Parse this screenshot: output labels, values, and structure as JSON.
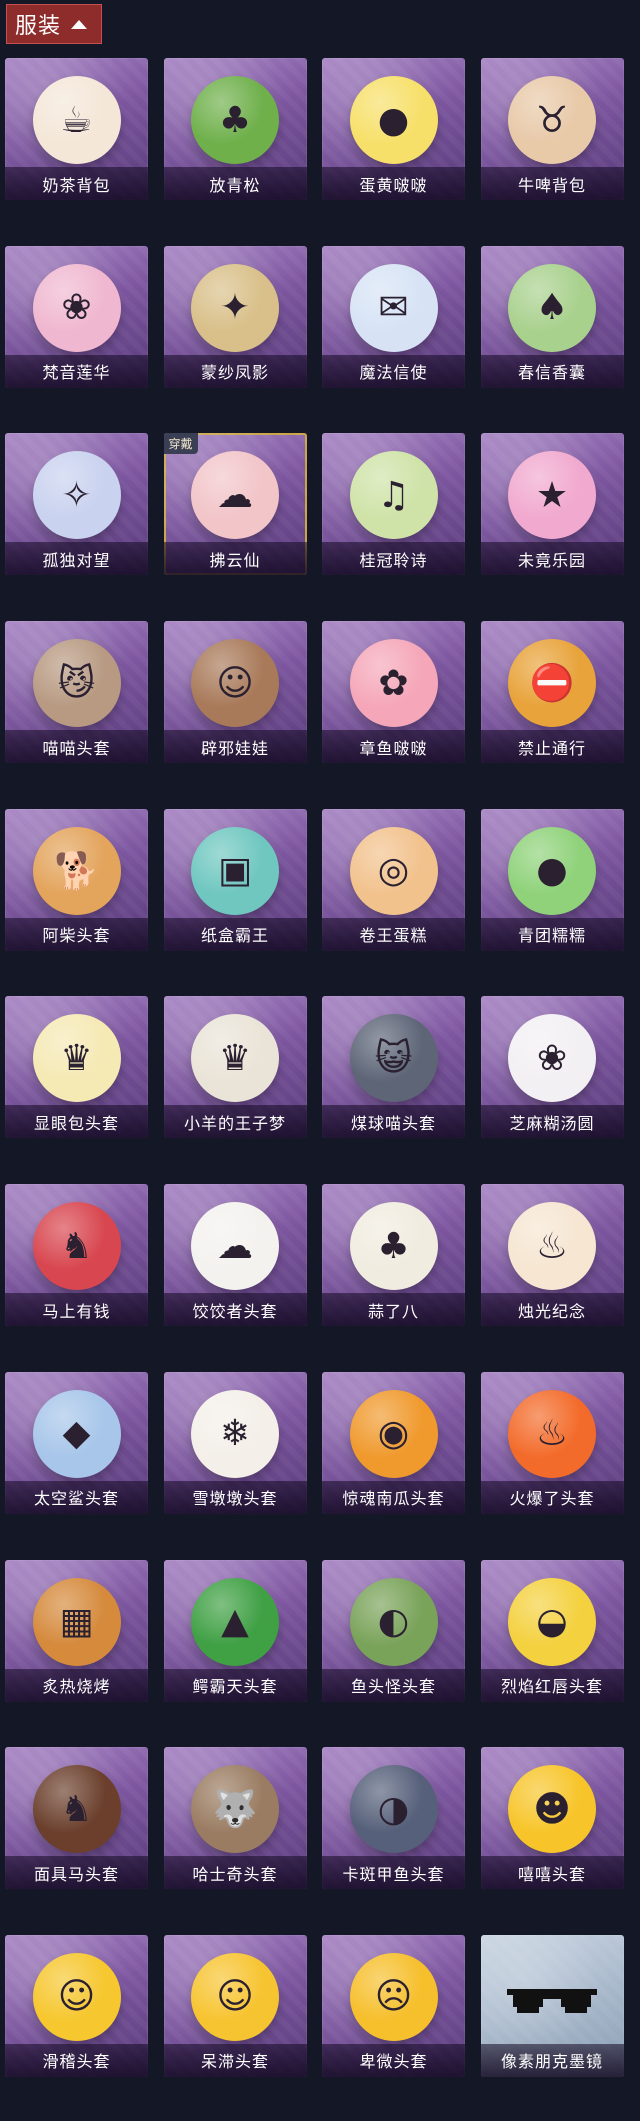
{
  "header": {
    "title": "服装",
    "toggle_icon": "chevron-up-icon"
  },
  "worn_badge": "穿戴",
  "items": [
    {
      "label": "奶茶背包",
      "color": "#f4e7d8",
      "glyph": "☕"
    },
    {
      "label": "放青松",
      "color": "#6fb04b",
      "glyph": "♣"
    },
    {
      "label": "蛋黄啵啵",
      "color": "#f7e06a",
      "glyph": "●"
    },
    {
      "label": "牛啤背包",
      "color": "#e8c9a8",
      "glyph": "♉"
    },
    {
      "label": "梵音莲华",
      "color": "#f0b8d0",
      "glyph": "❀"
    },
    {
      "label": "蒙纱凤影",
      "color": "#d9c08a",
      "glyph": "✦"
    },
    {
      "label": "魔法信使",
      "color": "#d7e3f5",
      "glyph": "✉"
    },
    {
      "label": "春信香囊",
      "color": "#a9d18e",
      "glyph": "♠"
    },
    {
      "label": "孤独对望",
      "color": "#c9d2ef",
      "glyph": "✧"
    },
    {
      "label": "拂云仙",
      "color": "#f2c5c9",
      "glyph": "☁",
      "worn": true
    },
    {
      "label": "桂冠聆诗",
      "color": "#cfe3a8",
      "glyph": "♫"
    },
    {
      "label": "未竟乐园",
      "color": "#f1a9cf",
      "glyph": "★"
    },
    {
      "label": "喵喵头套",
      "color": "#b89a82",
      "glyph": "😼"
    },
    {
      "label": "辟邪娃娃",
      "color": "#a97a5a",
      "glyph": "☺"
    },
    {
      "label": "章鱼啵啵",
      "color": "#f5a7b9",
      "glyph": "✿"
    },
    {
      "label": "禁止通行",
      "color": "#e8a33a",
      "glyph": "⛔"
    },
    {
      "label": "阿柴头套",
      "color": "#e3a45c",
      "glyph": "🐕"
    },
    {
      "label": "纸盒霸王",
      "color": "#6fc7c0",
      "glyph": "▣"
    },
    {
      "label": "卷王蛋糕",
      "color": "#f2c28d",
      "glyph": "◎"
    },
    {
      "label": "青团糯糯",
      "color": "#8fd27a",
      "glyph": "●"
    },
    {
      "label": "显眼包头套",
      "color": "#f5e9b4",
      "glyph": "♛"
    },
    {
      "label": "小羊的王子梦",
      "color": "#eae4d8",
      "glyph": "♛"
    },
    {
      "label": "煤球喵头套",
      "color": "#5d6577",
      "glyph": "😺"
    },
    {
      "label": "芝麻糊汤圆",
      "color": "#f3f0f4",
      "glyph": "❀"
    },
    {
      "label": "马上有钱",
      "color": "#d8464f",
      "glyph": "♞"
    },
    {
      "label": "饺饺者头套",
      "color": "#f4f2ef",
      "glyph": "☁"
    },
    {
      "label": "蒜了八",
      "color": "#f1ece0",
      "glyph": "♣"
    },
    {
      "label": "烛光纪念",
      "color": "#f6e6d2",
      "glyph": "♨"
    },
    {
      "label": "太空鲨头套",
      "color": "#a7c6ea",
      "glyph": "◆"
    },
    {
      "label": "雪墩墩头套",
      "color": "#f4efe9",
      "glyph": "❄"
    },
    {
      "label": "惊魂南瓜头套",
      "color": "#f09a2e",
      "glyph": "◉"
    },
    {
      "label": "火爆了头套",
      "color": "#f36b2a",
      "glyph": "♨"
    },
    {
      "label": "炙热烧烤",
      "color": "#d58a3c",
      "glyph": "▦"
    },
    {
      "label": "鳄霸天头套",
      "color": "#3fa044",
      "glyph": "▲"
    },
    {
      "label": "鱼头怪头套",
      "color": "#7aa35a",
      "glyph": "◐"
    },
    {
      "label": "烈焰红唇头套",
      "color": "#f4d13f",
      "glyph": "◒"
    },
    {
      "label": "面具马头套",
      "color": "#6b3f2c",
      "glyph": "♞"
    },
    {
      "label": "哈士奇头套",
      "color": "#9a7c62",
      "glyph": "🐺"
    },
    {
      "label": "卡斑甲鱼头套",
      "color": "#56607a",
      "glyph": "◑"
    },
    {
      "label": "嘻嘻头套",
      "color": "#f7c52a",
      "glyph": "☻"
    },
    {
      "label": "滑稽头套",
      "color": "#f6c72f",
      "glyph": "☺"
    },
    {
      "label": "呆滞头套",
      "color": "#f7c431",
      "glyph": "☺"
    },
    {
      "label": "卑微头套",
      "color": "#f6bf2c",
      "glyph": "☹"
    },
    {
      "label": "像素朋克墨镜",
      "color": "#c7d3e2",
      "glyph": "",
      "special": true
    }
  ]
}
